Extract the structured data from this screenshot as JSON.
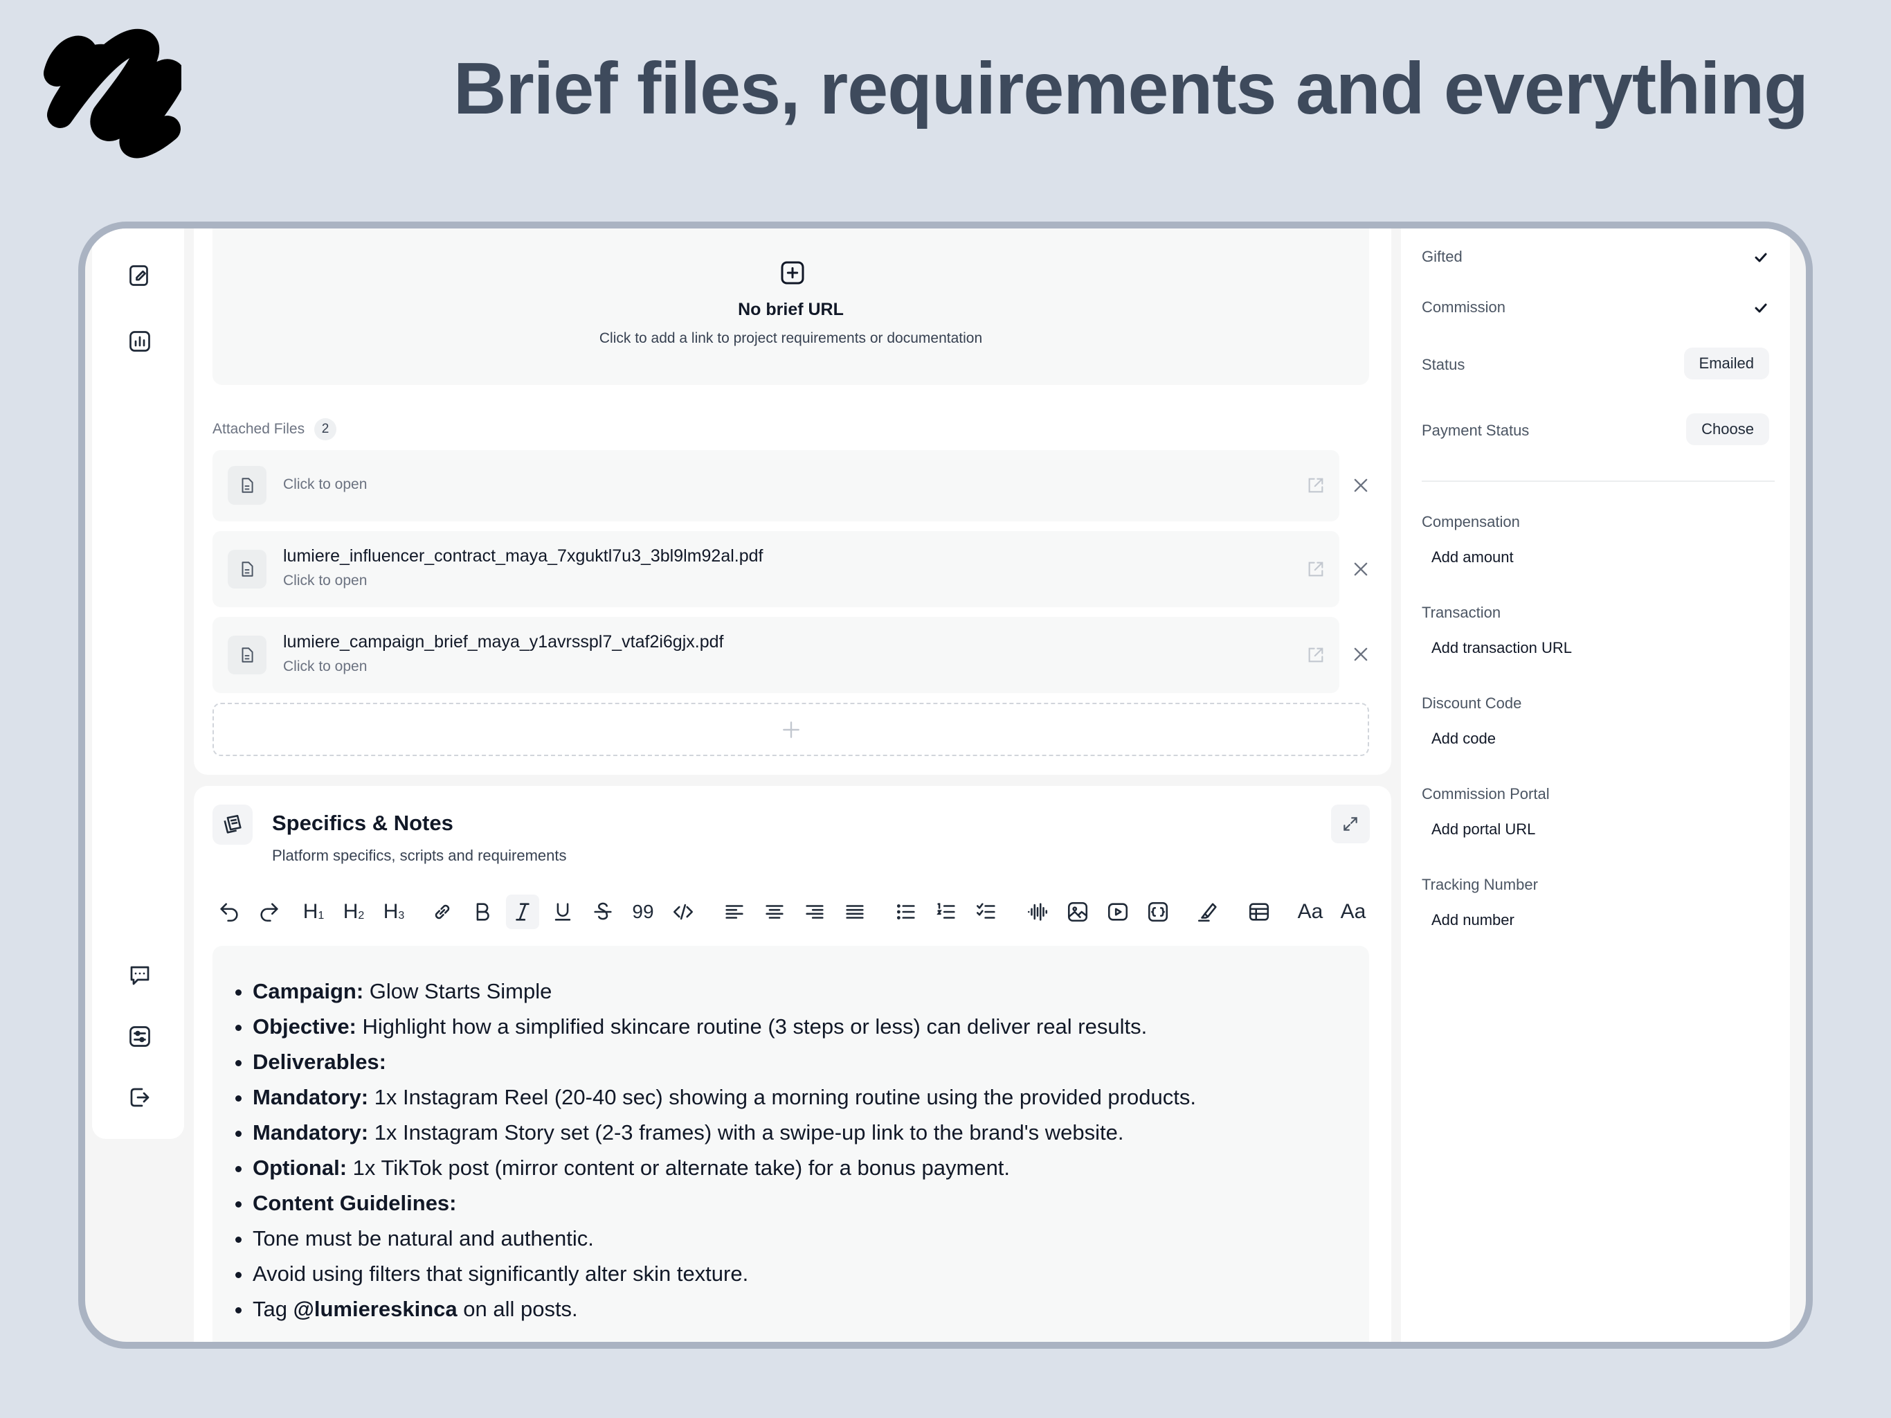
{
  "header": {
    "headline": "Brief files, requirements and everything"
  },
  "rail": {
    "top_icons": [
      "edit-note-icon",
      "analytics-icon"
    ],
    "bottom_icons": [
      "chat-icon",
      "settings-icon",
      "logout-icon"
    ]
  },
  "brief": {
    "title": "No brief URL",
    "subtitle": "Click to add a link to project requirements or documentation"
  },
  "files": {
    "label": "Attached Files",
    "count": "2",
    "items": [
      {
        "name": "",
        "sub": "Click to open"
      },
      {
        "name": "lumiere_influencer_contract_maya_7xguktl7u3_3bl9lm92al.pdf",
        "sub": "Click to open"
      },
      {
        "name": "lumiere_campaign_brief_maya_y1avrsspl7_vtaf2i6gjx.pdf",
        "sub": "Click to open"
      }
    ]
  },
  "notes": {
    "title": "Specifics & Notes",
    "subtitle": "Platform specifics, scripts and requirements",
    "toolbar": [
      "undo-icon",
      "redo-icon",
      "heading-1-icon",
      "heading-2-icon",
      "heading-3-icon",
      "link-icon",
      "bold-icon",
      "italic-icon",
      "underline-icon",
      "strikethrough-icon",
      "quote-icon",
      "code-icon",
      "align-left-icon",
      "align-center-icon",
      "align-right-icon",
      "align-justify-icon",
      "bullet-list-icon",
      "numbered-list-icon",
      "task-list-icon",
      "audio-icon",
      "image-icon",
      "video-icon",
      "embed-icon",
      "highlight-icon",
      "table-icon",
      "text-size-icon",
      "text-style-icon"
    ],
    "toolbar_text": {
      "h1": "H",
      "h2": "H",
      "h3": "H",
      "sub1": "1",
      "sub2": "2",
      "sub3": "3",
      "quote": "99",
      "aa1": "Aa",
      "aa2": "Aa"
    },
    "content": [
      {
        "bold": "Campaign:",
        "text": " Glow Starts Simple"
      },
      {
        "bold": "Objective:",
        "text": " Highlight how a simplified skincare routine (3 steps or less) can deliver real results."
      },
      {
        "bold": "Deliverables:",
        "text": ""
      },
      {
        "bold": "Mandatory:",
        "text": " 1x Instagram Reel (20-40 sec) showing a morning routine using the provided products."
      },
      {
        "bold": "Mandatory:",
        "text": " 1x Instagram Story set (2-3 frames) with a swipe-up link to the brand's website."
      },
      {
        "bold": "Optional:",
        "text": " 1x TikTok post (mirror content or alternate take) for a bonus payment."
      },
      {
        "bold": "Content Guidelines:",
        "text": ""
      },
      {
        "bold": "",
        "text": "Tone must be natural and authentic."
      },
      {
        "bold": "",
        "text": "Avoid using filters that significantly alter skin texture."
      },
      {
        "pre": "Tag ",
        "bold": "@lumiereskinca",
        "text": " on all posts."
      }
    ]
  },
  "side": {
    "gifted": "Gifted",
    "commission": "Commission",
    "status_label": "Status",
    "status_value": "Emailed",
    "payment_label": "Payment Status",
    "payment_value": "Choose",
    "fields": [
      {
        "label": "Compensation",
        "value": "Add amount"
      },
      {
        "label": "Transaction",
        "value": "Add transaction URL"
      },
      {
        "label": "Discount Code",
        "value": "Add code"
      },
      {
        "label": "Commission Portal",
        "value": "Add portal URL"
      },
      {
        "label": "Tracking Number",
        "value": "Add number"
      }
    ]
  }
}
